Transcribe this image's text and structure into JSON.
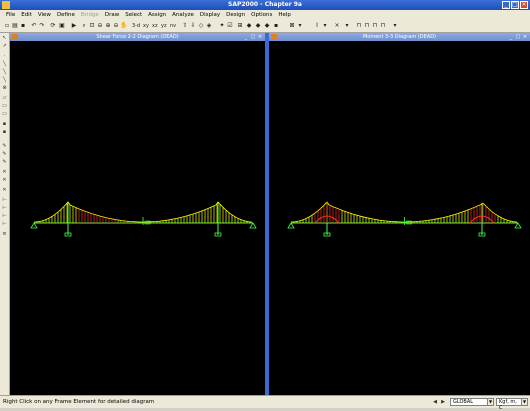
{
  "app": {
    "title": "SAP2000 - Chapter 9a"
  },
  "menu": {
    "items": [
      "File",
      "Edit",
      "View",
      "Define",
      "Bridge",
      "Draw",
      "Select",
      "Assign",
      "Analyze",
      "Display",
      "Design",
      "Options",
      "Help"
    ]
  },
  "toolbar": {
    "view_3d_label": "3-d",
    "view_xy_label": "xy",
    "view_xz_label": "xz",
    "view_yz_label": "yz",
    "view_nv_label": "nv"
  },
  "panes": [
    {
      "title": "Shear Force 2-2 Diagram   (DEAD)",
      "diagram": "shear"
    },
    {
      "title": "Moment 3-3 Diagram   (DEAD)",
      "diagram": "moment"
    }
  ],
  "status": {
    "text": "Right Click on any Frame Element for detailed diagram",
    "coord_system": "GLOBAL",
    "units": "Kgf, m, C"
  },
  "colors": {
    "pane_background": "#000000",
    "structure_green": "#44ff44",
    "cable_yellow": "#ffff00",
    "diagram_red": "#ff3020",
    "diagram_orange": "#ff8000"
  }
}
